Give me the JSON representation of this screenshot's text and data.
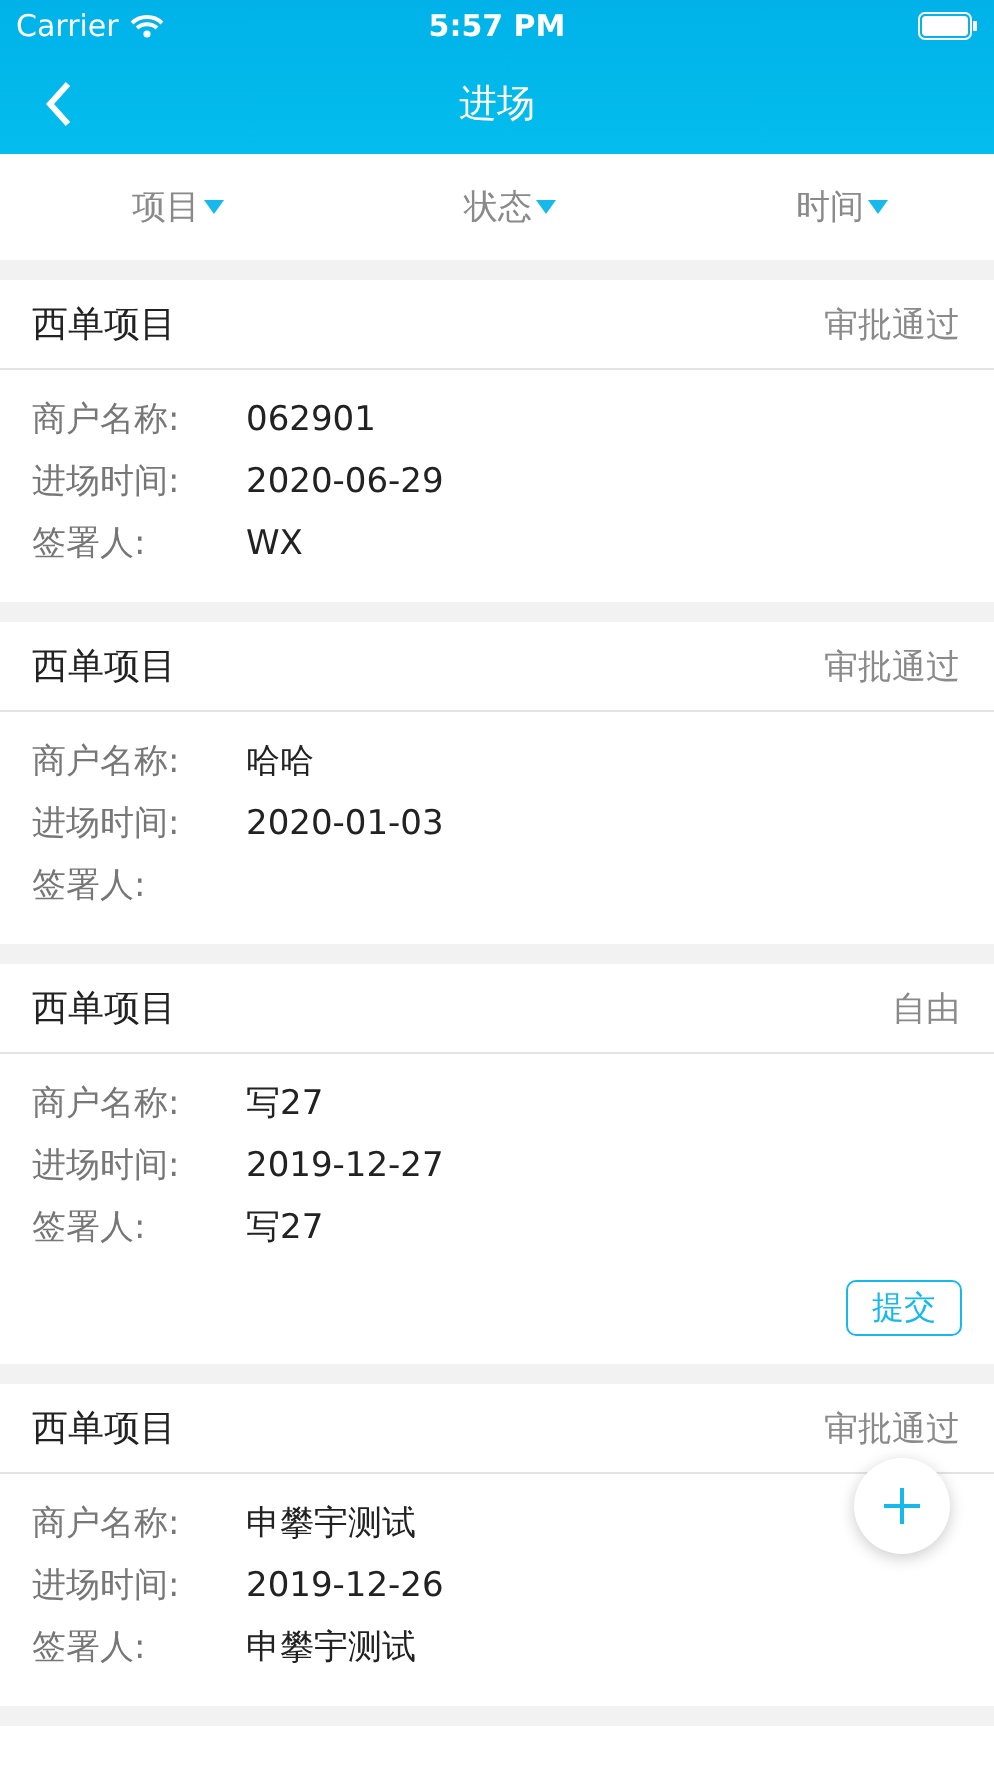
{
  "status_bar": {
    "carrier": "Carrier",
    "time": "5:57 PM"
  },
  "nav": {
    "title": "进场"
  },
  "filters": [
    {
      "label": "项目"
    },
    {
      "label": "状态"
    },
    {
      "label": "时间"
    }
  ],
  "cards": [
    {
      "project": "西单项目",
      "status": "审批通过",
      "fields": [
        {
          "label": "商户名称:",
          "value": "062901"
        },
        {
          "label": "进场时间:",
          "value": "2020-06-29"
        },
        {
          "label": "签署人:",
          "value": "WX"
        }
      ]
    },
    {
      "project": "西单项目",
      "status": "审批通过",
      "fields": [
        {
          "label": "商户名称:",
          "value": "哈哈"
        },
        {
          "label": "进场时间:",
          "value": "2020-01-03"
        },
        {
          "label": "签署人:"
        }
      ]
    },
    {
      "project": "西单项目",
      "status": "自由",
      "fields": [
        {
          "label": "商户名称:",
          "value": "写27"
        },
        {
          "label": "进场时间:",
          "value": "2019-12-27"
        },
        {
          "label": "签署人:",
          "value": "写27"
        }
      ],
      "action": "提交"
    },
    {
      "project": "西单项目",
      "status": "审批通过",
      "fields": [
        {
          "label": "商户名称:",
          "value": "申攀宇测试"
        },
        {
          "label": "进场时间:",
          "value": "2019-12-26"
        },
        {
          "label": "签署人:",
          "value": "申攀宇测试"
        }
      ]
    }
  ]
}
